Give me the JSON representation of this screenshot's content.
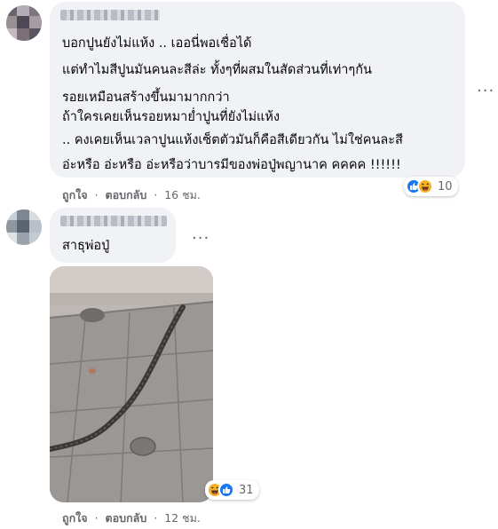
{
  "comments": [
    {
      "author_name": "",
      "text_lines": [
        "บอกปูนยังไม่แห้ง .. เออนี่พอเชื่อได้",
        "แต่ทำไมสีปูนมันคนละสีล่ะ ทั้งๆที่ผสมในสัดส่วนที่เท่าๆกัน",
        "รอยเหมือนสร้างขึ้นมามากกว่า",
        "ถ้าใครเคยเห็นรอยหมาย่ำปูนที่ยังไม่แห้ง",
        ".. คงเคยเห็นเวลาปูนแห้งเซ็ตตัวมันก็คือสีเดียวกัน ไม่ใช่คนละสี",
        "อ่ะหรือ อ่ะหรือ อ่ะหรือว่าบารมีของพ่อปู่พญานาค คคคค !!!!!!"
      ],
      "like_label": "ถูกใจ",
      "reply_label": "ตอบกลับ",
      "separator": "·",
      "time": "16 ชม.",
      "reaction_count": "10",
      "reaction_icons": [
        "like-icon",
        "haha-icon"
      ]
    },
    {
      "author_name": "",
      "text": "สาธุพ่อปู่",
      "like_label": "ถูกใจ",
      "reply_label": "ตอบกลับ",
      "separator": "·",
      "time": "12 ชม.",
      "reaction_count": "31",
      "reaction_icons": [
        "haha-icon",
        "like-icon"
      ]
    }
  ],
  "more_icon": "···",
  "colors": {
    "bubble": "#f0f2f5",
    "secondary_text": "#65676b",
    "like_blue": "#1877f2",
    "haha_yellow": "#f7b125"
  }
}
